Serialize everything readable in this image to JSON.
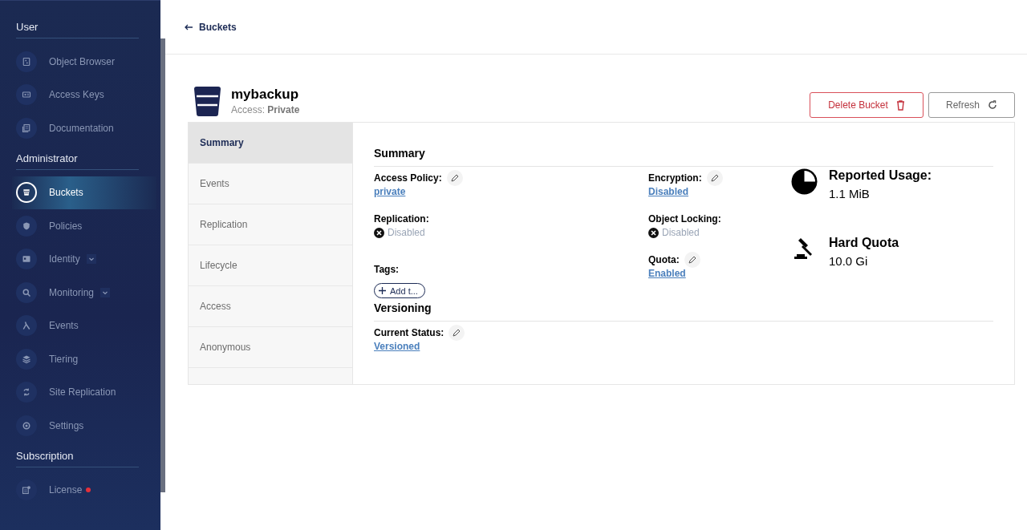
{
  "sidebar": {
    "sections": [
      {
        "title": "User",
        "items": [
          {
            "label": "Object Browser",
            "selected": false,
            "expandable": false,
            "notification": false
          },
          {
            "label": "Access Keys",
            "selected": false,
            "expandable": false,
            "notification": false
          },
          {
            "label": "Documentation",
            "selected": false,
            "expandable": false,
            "notification": false
          }
        ]
      },
      {
        "title": "Administrator",
        "items": [
          {
            "label": "Buckets",
            "selected": true,
            "expandable": false,
            "notification": false
          },
          {
            "label": "Policies",
            "selected": false,
            "expandable": false,
            "notification": false
          },
          {
            "label": "Identity",
            "selected": false,
            "expandable": true,
            "notification": false
          },
          {
            "label": "Monitoring",
            "selected": false,
            "expandable": true,
            "notification": false
          },
          {
            "label": "Events",
            "selected": false,
            "expandable": false,
            "notification": false
          },
          {
            "label": "Tiering",
            "selected": false,
            "expandable": false,
            "notification": false
          },
          {
            "label": "Site Replication",
            "selected": false,
            "expandable": false,
            "notification": false
          },
          {
            "label": "Settings",
            "selected": false,
            "expandable": false,
            "notification": false
          }
        ]
      },
      {
        "title": "Subscription",
        "items": [
          {
            "label": "License",
            "selected": false,
            "expandable": false,
            "notification": true
          }
        ]
      }
    ]
  },
  "breadcrumb": {
    "back": "Buckets"
  },
  "bucket": {
    "name": "mybackup",
    "access_label": "Access:",
    "access_value": "Private"
  },
  "actions": [
    {
      "label": "Delete Bucket",
      "kind": "danger"
    },
    {
      "label": "Refresh",
      "kind": "refresh"
    }
  ],
  "tabs": [
    {
      "label": "Summary",
      "selected": true
    },
    {
      "label": "Events",
      "selected": false
    },
    {
      "label": "Replication",
      "selected": false
    },
    {
      "label": "Lifecycle",
      "selected": false
    },
    {
      "label": "Access",
      "selected": false
    },
    {
      "label": "Anonymous",
      "selected": false
    }
  ],
  "summary": {
    "title": "Summary",
    "left": [
      {
        "label": "Access Policy:",
        "kind": "link",
        "value": "private",
        "editable": true
      },
      {
        "label": "Replication:",
        "kind": "status",
        "value": "Disabled",
        "editable": false
      },
      {
        "label": "Tags:",
        "kind": "tags",
        "value": "Add t...",
        "editable": false
      }
    ],
    "right": [
      {
        "label": "Encryption:",
        "kind": "link",
        "value": "Disabled",
        "editable": true
      },
      {
        "label": "Object Locking:",
        "kind": "status",
        "value": "Disabled",
        "editable": false
      },
      {
        "label": "Quota:",
        "kind": "link",
        "value": "Enabled",
        "editable": true
      }
    ],
    "usage": [
      {
        "kind": "usage",
        "label": "Reported Usage:",
        "value": "1.1 MiB"
      },
      {
        "kind": "quota",
        "label": "Hard Quota",
        "value": "10.0 Gi"
      }
    ]
  },
  "versioning": {
    "title": "Versioning",
    "fields": [
      {
        "label": "Current Status:",
        "kind": "link",
        "value": "Versioned",
        "editable": true
      }
    ]
  }
}
